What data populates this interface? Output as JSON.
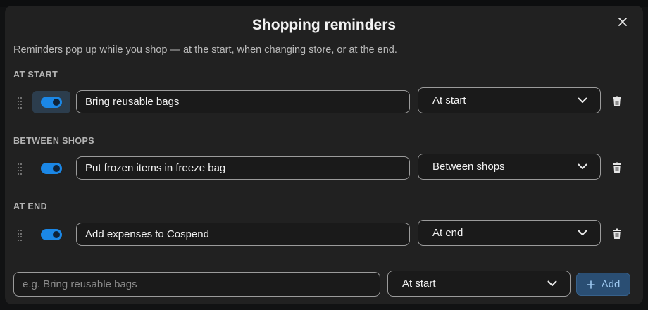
{
  "dialog": {
    "title": "Shopping reminders",
    "description": "Reminders pop up while you shop — at the start, when changing store, or at the end."
  },
  "sections": [
    {
      "label": "AT START",
      "reminder": {
        "text": "Bring reusable bags",
        "enabled": true,
        "timing": "At start"
      }
    },
    {
      "label": "BETWEEN SHOPS",
      "reminder": {
        "text": "Put frozen items in freeze bag",
        "enabled": true,
        "timing": "Between shops"
      }
    },
    {
      "label": "AT END",
      "reminder": {
        "text": "Add expenses to Cospend",
        "enabled": true,
        "timing": "At end"
      }
    }
  ],
  "new_reminder": {
    "placeholder": "e.g. Bring reusable bags",
    "timing": "At start",
    "add_label": "Add"
  },
  "icons": {
    "close": "close-icon",
    "drag": "drag-handle-icon",
    "chevron": "chevron-down-icon",
    "delete": "trash-icon",
    "add": "plus-icon"
  },
  "colors": {
    "dialog_bg": "#212121",
    "accent": "#1b87e6",
    "add_button_bg": "#2a4e73"
  }
}
